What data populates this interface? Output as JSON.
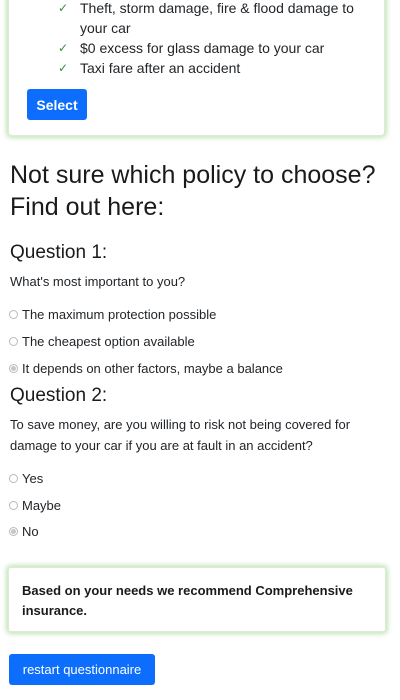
{
  "policy_card": {
    "features": [
      {
        "icon": "checkmark-icon",
        "text": "Theft, storm damage, fire & flood damage to your car"
      },
      {
        "icon": "checkmark-icon",
        "text": "$0 excess for glass damage to your car"
      },
      {
        "icon": "checkmark-icon",
        "text": "Taxi fare after an accident"
      }
    ],
    "select_label": "Select",
    "check_glyph": "✓"
  },
  "heading": "Not sure which policy to choose? Find out here:",
  "question1": {
    "title": "Question 1:",
    "text": "What's most important to you?",
    "options": [
      {
        "label": "The maximum protection possible",
        "checked": false
      },
      {
        "label": "The cheapest option available",
        "checked": false
      },
      {
        "label": "It depends on other factors, maybe a balance",
        "checked": true
      }
    ]
  },
  "question2": {
    "title": "Question 2:",
    "text": "To save money, are you willing to risk not being covered for damage to your car if you are at fault in an accident?",
    "options": [
      {
        "label": "Yes",
        "checked": false
      },
      {
        "label": "Maybe",
        "checked": false
      },
      {
        "label": "No",
        "checked": true
      }
    ]
  },
  "recommendation": "Based on your needs we recommend Comprehensive insurance.",
  "restart_label": "restart questionnaire",
  "colors": {
    "primary_button": "#0d6efd",
    "card_glow": "#78c85a",
    "check": "#2f8f3a"
  }
}
